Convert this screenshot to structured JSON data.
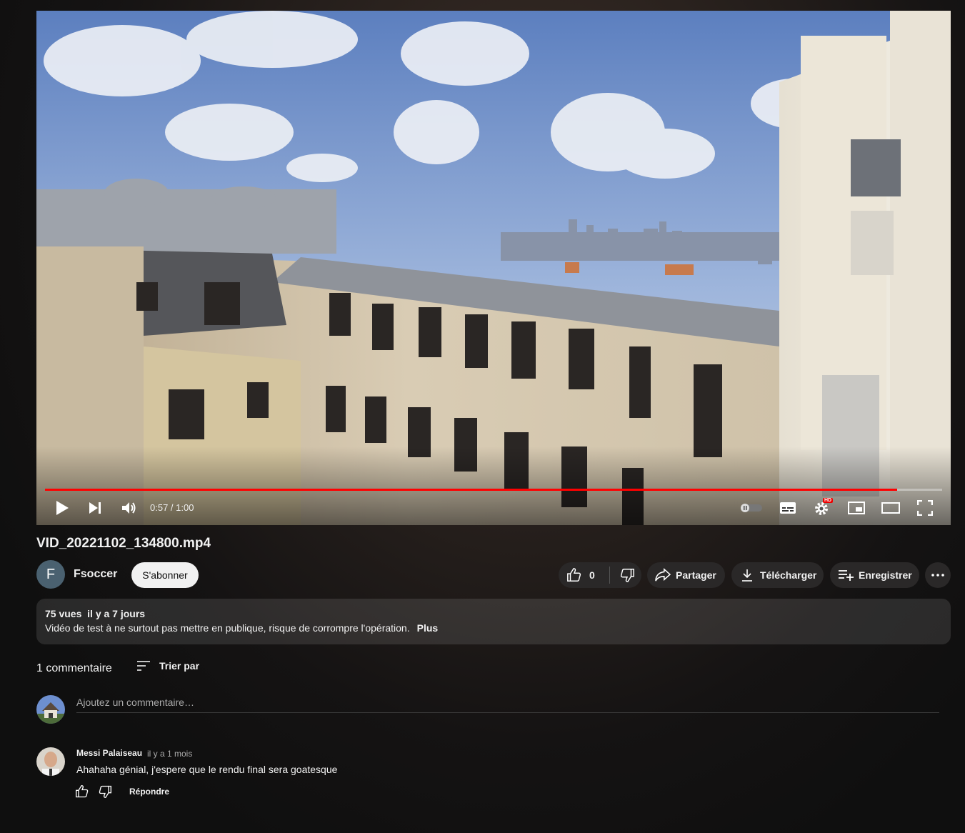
{
  "video": {
    "current_time": "0:57",
    "duration": "1:00",
    "time_display": "0:57 / 1:00",
    "progress_fraction": 0.95,
    "hd_badge": "HD"
  },
  "title": "VID_20221102_134800.mp4",
  "channel": {
    "initial": "F",
    "name": "Fsoccer",
    "subscribe_label": "S'abonner"
  },
  "actions": {
    "like_count": "0",
    "share_label": "Partager",
    "download_label": "Télécharger",
    "save_label": "Enregistrer"
  },
  "description": {
    "views": "75 vues",
    "date": "il y a 7 jours",
    "text": "Vidéo de test à ne surtout pas mettre en publique, risque de corrompre l'opération.",
    "more_label": "Plus"
  },
  "comments": {
    "count_label": "1 commentaire",
    "sort_label": "Trier par",
    "placeholder": "Ajoutez un commentaire…",
    "items": [
      {
        "author": "Messi Palaiseau",
        "time": "il y a 1 mois",
        "text": "Ahahaha génial, j'espere que le rendu final sera goatesque",
        "reply_label": "Répondre"
      }
    ]
  },
  "colors": {
    "progress": "#ff0000",
    "page_bg": "#0f0f0f",
    "pill_bg": "#2a2828"
  }
}
